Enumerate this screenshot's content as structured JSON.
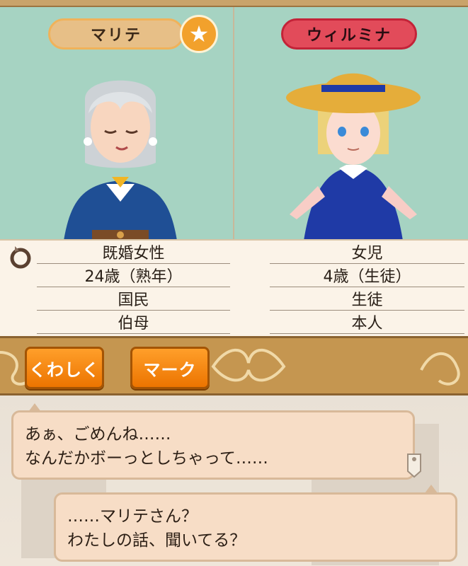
{
  "characters": {
    "left": {
      "name": "マリテ",
      "info": [
        "既婚女性",
        "24歳（熟年）",
        "国民",
        "伯母"
      ]
    },
    "right": {
      "name": "ウィルミナ",
      "info": [
        "女児",
        "4歳（生徒）",
        "生徒",
        "本人"
      ]
    }
  },
  "favorite_icon": "★",
  "buttons": {
    "detail": "くわしく",
    "mark": "マーク"
  },
  "dialogue": {
    "first": {
      "line1": "あぁ、ごめんね……",
      "line2": "なんだかボーっとしちゃって……"
    },
    "second": {
      "line1": "……マリテさん？",
      "line2": "わたしの話、聞いてる？"
    }
  },
  "icons": {
    "status_icon": "ring-icon",
    "favorite": "star-icon",
    "bubble_tag": "tag-icon"
  },
  "colors": {
    "panel_bg": "#a6d3c2",
    "left_badge": "#e7bf87",
    "right_badge": "#e24b5a",
    "button": "#ff8a10",
    "bar": "#c59650"
  }
}
